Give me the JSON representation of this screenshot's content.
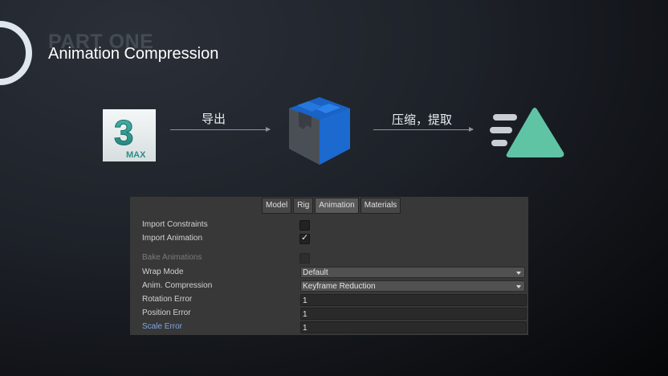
{
  "slide": {
    "part_label": "PART ONE",
    "title": "Animation Compression"
  },
  "pipeline": {
    "source_logo": {
      "icon": "3ds-max-icon",
      "digit": "3",
      "text": "MAX"
    },
    "step1_label": "导出",
    "middle_logo": {
      "icon": "unity-package-icon"
    },
    "step2_label": "压缩，提取",
    "target_logo": {
      "icon": "triangle-motion-icon"
    }
  },
  "inspector": {
    "tabs": [
      {
        "label": "Model",
        "active": false
      },
      {
        "label": "Rig",
        "active": false
      },
      {
        "label": "Animation",
        "active": true
      },
      {
        "label": "Materials",
        "active": false
      }
    ],
    "import_constraints": {
      "label": "Import Constraints",
      "checked": false
    },
    "import_animation": {
      "label": "Import Animation",
      "checked": true,
      "mark": "✓"
    },
    "bake_animations": {
      "label": "Bake Animations",
      "checked": false,
      "disabled": true
    },
    "wrap_mode": {
      "label": "Wrap Mode",
      "value": "Default"
    },
    "anim_compression": {
      "label": "Anim. Compression",
      "value": "Keyframe Reduction"
    },
    "rotation_error": {
      "label": "Rotation Error",
      "value": "1"
    },
    "position_error": {
      "label": "Position Error",
      "value": "1"
    },
    "scale_error": {
      "label": "Scale Error",
      "value": "1"
    }
  },
  "colors": {
    "accent_blue": "#1f6fd6",
    "accent_teal": "#5ec4a4",
    "max_teal": "#2f9a90",
    "highlight_label": "#7ea7e6"
  }
}
